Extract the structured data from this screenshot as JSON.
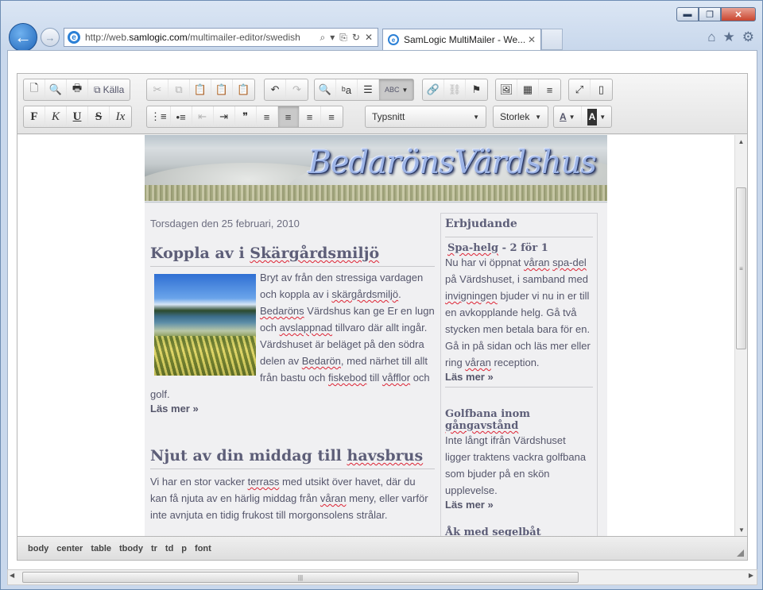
{
  "window": {
    "controls": {
      "minimize": "▬",
      "maximize": "❐",
      "close": "✕"
    }
  },
  "nav": {
    "back_glyph": "←",
    "forward_glyph": "→",
    "url_prefix": "http://web.",
    "url_host": "samlogic.com",
    "url_rest": "/multimailer-editor/swedish",
    "addr_icons": [
      "⌕",
      "▾",
      "⎘",
      "↻",
      "✕"
    ]
  },
  "tab": {
    "title": "SamLogic MultiMailer - We...",
    "close": "✕"
  },
  "browser_tools": {
    "home": "⌂",
    "favorites": "★",
    "settings": "⚙"
  },
  "toolbar": {
    "row1": {
      "group1": [
        "🗋",
        "🔍",
        "🖶"
      ],
      "source_label": "Källa",
      "group2": [
        "✂",
        "⧉",
        "📋",
        "📋",
        "📋"
      ],
      "group3": [
        "↶",
        "↷"
      ],
      "group4": [
        "🔍",
        "ᵇa",
        "☰"
      ],
      "spell_label": "ABC",
      "group5": [
        "🔗",
        "⛓",
        "⚑"
      ],
      "group6": [
        "🖼",
        "▦",
        "≡"
      ],
      "group7": [
        "⤢",
        "▯"
      ]
    },
    "row2": {
      "format": [
        "F",
        "K",
        "U",
        "S"
      ],
      "clear": "Ix",
      "lists": [
        "⋮≡",
        "•≡"
      ],
      "indent": [
        "⇤",
        "⇥"
      ],
      "quote": "❞",
      "align": [
        "≡",
        "≡",
        "≡",
        "≡"
      ],
      "font_label": "Typsnitt",
      "size_label": "Storlek",
      "text_color": "A",
      "bg_color": "A"
    }
  },
  "newsletter": {
    "brand": "BedarönsVärdshus",
    "date": "Torsdagen den 25 februari, 2010",
    "article1": {
      "title_pre": "Koppla av i ",
      "title_sp": "Skärgårdsmiljö",
      "text_a": "Bryt av från den stressiga vardagen och koppla av i ",
      "sp1": "skärgårdsmiljö",
      "text_b": ". ",
      "sp2": "Bedaröns",
      "text_c": " Värdshus kan ge Er en lugn och ",
      "sp3": "avslappnad",
      "text_d": " tillvaro där allt ingår. Värdshuset är beläget på den södra delen av ",
      "sp4": "Bedarön",
      "text_e": ", med närhet till allt från bastu och ",
      "sp5": "fiskebod",
      "text_f": " till ",
      "sp6": "våfflor",
      "text_g": " och golf.",
      "more": "Läs mer »"
    },
    "article2": {
      "title_pre": "Njut av din middag till ",
      "title_sp": "havsbrus",
      "text_a": "Vi har en stor vacker ",
      "sp1": "terrass",
      "text_b": " med utsikt över havet, där du kan få njuta av en härlig middag från ",
      "sp2": "våran",
      "text_c": " meny, eller varför inte avnjuta en tidig frukost till morgonsolens strålar."
    },
    "sidebar": {
      "heading": "Erbjudande",
      "offer1": {
        "title_sp": "Spa-helg",
        "title_rest": " - 2 för 1",
        "text_a": "Nu har vi öppnat ",
        "sp1": "våran",
        "text_b": " ",
        "sp2": "spa-del",
        "text_c": " på Värdshuset, i samband med ",
        "sp3": "invigningen",
        "text_d": " bjuder vi nu in er till en avkopplande helg. Gå två stycken men betala bara för en. Gå in på sidan och läs mer eller ring ",
        "sp4": "våran",
        "text_e": " reception.",
        "more": "Läs mer »"
      },
      "offer2": {
        "title_pre": "Golfbana inom ",
        "title_sp": "gångavstånd",
        "text": "Inte långt ifrån Värdshuset ligger traktens vackra golfbana som bjuder på en skön upplevelse.",
        "more": "Läs mer »"
      },
      "offer3": {
        "title": "Åk med segelbåt"
      }
    }
  },
  "statusbar": {
    "crumbs": [
      "body",
      "center",
      "table",
      "tbody",
      "tr",
      "td",
      "p",
      "font"
    ]
  },
  "scrollbar": {
    "up": "▲",
    "down": "▼",
    "left": "◀",
    "right": "▶",
    "grip": "≡",
    "hgrip": "|||"
  },
  "colors": {
    "accent": "#1f65b9",
    "heading": "#5d5e78",
    "body_text": "#55566b",
    "spell_error": "#dd2233"
  }
}
